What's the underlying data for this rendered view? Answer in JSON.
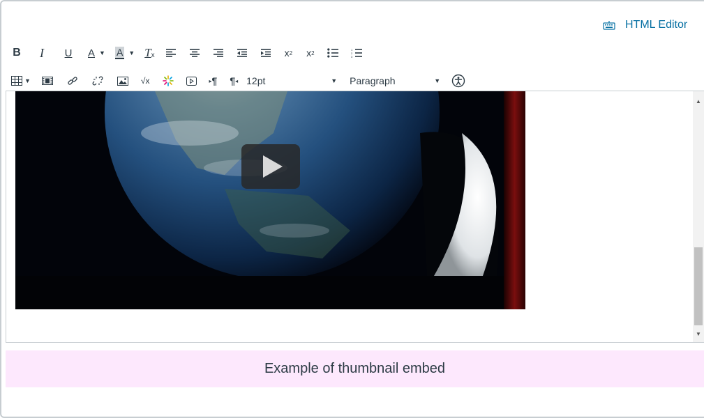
{
  "header": {
    "html_editor_label": "HTML Editor",
    "html_editor_icon": "keyboard-icon"
  },
  "toolbar": {
    "row1": [
      {
        "name": "bold-button",
        "glyph": "B"
      },
      {
        "name": "italic-button",
        "glyph": "I"
      },
      {
        "name": "underline-button",
        "glyph": "U"
      },
      {
        "name": "text-color-button",
        "glyph": "A"
      },
      {
        "name": "background-color-button",
        "glyph": "A"
      },
      {
        "name": "clear-formatting-button",
        "glyph": "Tx"
      },
      {
        "name": "align-left-button"
      },
      {
        "name": "align-center-button"
      },
      {
        "name": "align-right-button"
      },
      {
        "name": "outdent-button"
      },
      {
        "name": "indent-button"
      },
      {
        "name": "superscript-button",
        "glyph": "x²"
      },
      {
        "name": "subscript-button",
        "glyph": "x₂"
      },
      {
        "name": "bullet-list-button"
      },
      {
        "name": "numbered-list-button"
      }
    ],
    "font_size": "12pt",
    "block_format": "Paragraph"
  },
  "content": {
    "media": "earth-video-thumbnail",
    "play_icon": "play-icon"
  },
  "caption": "Example of thumbnail embed",
  "colors": {
    "link": "#0770a3",
    "caption_bg": "#fde8fd",
    "text": "#2d3b45"
  }
}
